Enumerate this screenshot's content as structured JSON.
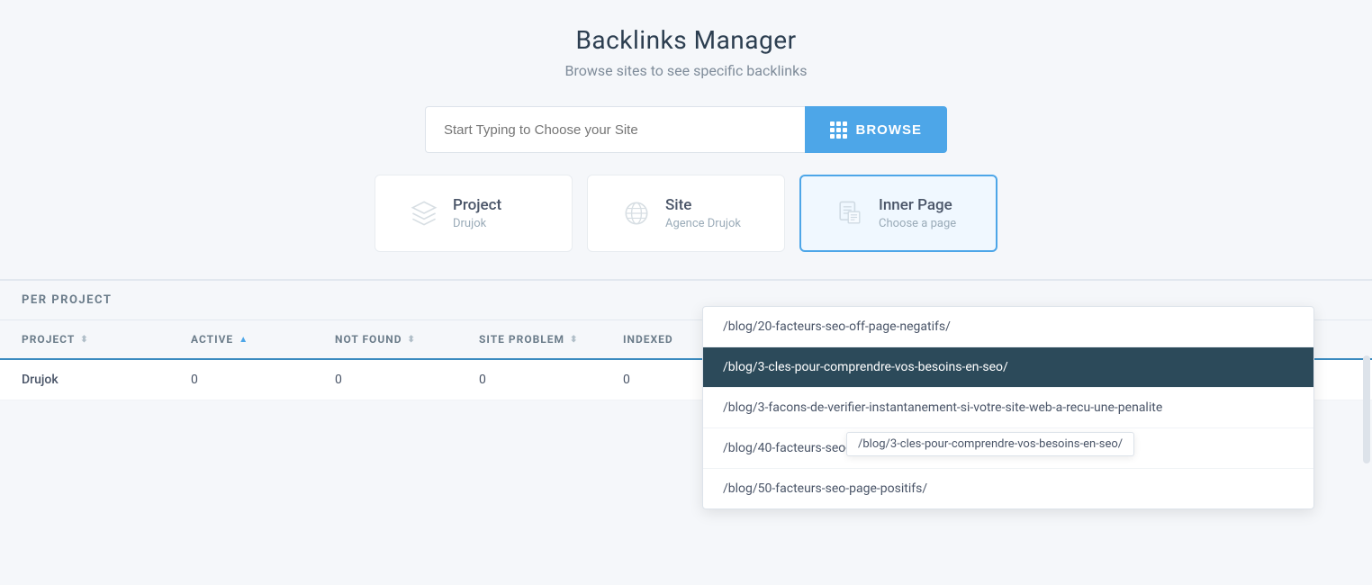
{
  "page": {
    "title": "Backlinks Manager",
    "subtitle": "Browse sites to see specific backlinks"
  },
  "search": {
    "placeholder": "Start Typing to Choose your Site",
    "browse_label": "BROWSE"
  },
  "cards": [
    {
      "id": "project",
      "title": "Project",
      "subtitle": "Drujok"
    },
    {
      "id": "site",
      "title": "Site",
      "subtitle": "Agence Drujok"
    },
    {
      "id": "innerpage",
      "title": "Inner Page",
      "subtitle": "Choose a page"
    }
  ],
  "dropdown": {
    "items": [
      {
        "path": "/blog/20-facteurs-seo-off-page-negatifs/",
        "active": false
      },
      {
        "path": "/blog/3-cles-pour-comprendre-vos-besoins-en-seo/",
        "active": true
      },
      {
        "path": "/blog/3-facons-de-verifier-instantanement-si-votre-site-web-a-recu-une-penalite",
        "active": false
      },
      {
        "path": "/blog/40-facteurs-seo-on-page-negatifs/",
        "active": false
      },
      {
        "path": "/blog/50-facteurs-seo-page-positifs/",
        "active": false
      }
    ]
  },
  "tooltip": {
    "text": "/blog/3-cles-pour-comprendre-vos-besoins-en-seo/"
  },
  "section": {
    "per_project_label": "PER PROJECT"
  },
  "table": {
    "columns": [
      {
        "id": "project",
        "label": "PROJECT",
        "sort": "neutral"
      },
      {
        "id": "active",
        "label": "ACTIVE",
        "sort": "up"
      },
      {
        "id": "not_found",
        "label": "NOT FOUND",
        "sort": "neutral"
      },
      {
        "id": "site_problem",
        "label": "SITE PROBLEM",
        "sort": "neutral"
      },
      {
        "id": "indexed",
        "label": "INDEXED",
        "sort": "neutral"
      }
    ],
    "rows": [
      {
        "project": "Drujok",
        "active": "0",
        "not_found": "0",
        "site_problem": "0",
        "indexed": "0"
      }
    ]
  },
  "colors": {
    "accent_blue": "#4da6e8",
    "dark_header": "#2c4a5a",
    "text_muted": "#9aabb8"
  }
}
